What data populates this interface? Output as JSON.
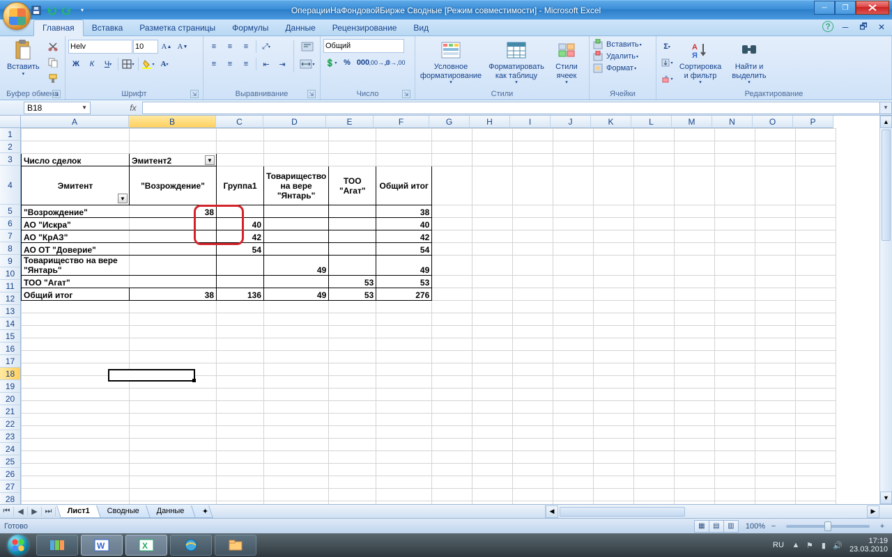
{
  "window": {
    "title": "ОперацииНаФондовойБирже  Сводные  [Режим совместимости] - Microsoft Excel"
  },
  "tabs": {
    "items": [
      "Главная",
      "Вставка",
      "Разметка страницы",
      "Формулы",
      "Данные",
      "Рецензирование",
      "Вид"
    ],
    "active_index": 0
  },
  "ribbon": {
    "clipboard": {
      "label": "Буфер обмена",
      "paste": "Вставить"
    },
    "font": {
      "label": "Шрифт",
      "family": "Helv",
      "size": "10"
    },
    "alignment": {
      "label": "Выравнивание"
    },
    "number": {
      "label": "Число",
      "format": "Общий"
    },
    "styles": {
      "label": "Стили",
      "conditional": "Условное форматирование",
      "as_table": "Форматировать как таблицу",
      "cell_styles": "Стили ячеек"
    },
    "cells": {
      "label": "Ячейки",
      "insert": "Вставить",
      "delete": "Удалить",
      "format": "Формат"
    },
    "editing": {
      "label": "Редактирование",
      "sort": "Сортировка и фильтр",
      "find": "Найти и выделить"
    }
  },
  "formula_bar": {
    "namebox": "B18",
    "fx_label": "fx",
    "formula": ""
  },
  "column_letters": [
    "A",
    "B",
    "C",
    "D",
    "E",
    "F",
    "G",
    "H",
    "I",
    "J",
    "K",
    "L",
    "M",
    "N",
    "O",
    "P"
  ],
  "row_numbers": [
    1,
    2,
    3,
    4,
    5,
    6,
    7,
    8,
    9,
    10,
    11,
    12,
    13,
    14,
    15,
    16,
    17,
    18,
    19,
    20,
    21,
    22,
    23,
    24,
    25,
    26,
    27,
    28
  ],
  "pivot": {
    "measure_label": "Число сделок",
    "col_field": "Эмитент2",
    "row_field": "Эмитент",
    "col_headers": [
      "\"Возрождение\"",
      "Группа1",
      "Товарищество на вере \"Янтарь\"",
      "ТОО \"Агат\"",
      "Общий итог"
    ],
    "rows": [
      {
        "label": "\"Возрождение\"",
        "values": [
          "38",
          "",
          "",
          "",
          "38"
        ]
      },
      {
        "label": "АО \"Искра\"",
        "values": [
          "",
          "40",
          "",
          "",
          "40"
        ]
      },
      {
        "label": "АО \"КрАЗ\"",
        "values": [
          "",
          "42",
          "",
          "",
          "42"
        ]
      },
      {
        "label": "АО ОТ \"Доверие\"",
        "values": [
          "",
          "54",
          "",
          "",
          "54"
        ]
      },
      {
        "label": "Товарищество на вере \"Янтарь\"",
        "values": [
          "",
          "",
          "49",
          "",
          "49"
        ]
      },
      {
        "label": "ТОО \"Агат\"",
        "values": [
          "",
          "",
          "",
          "53",
          "53"
        ]
      }
    ],
    "total_label": "Общий итог",
    "totals": [
      "38",
      "136",
      "49",
      "53",
      "276"
    ]
  },
  "sheets": {
    "items": [
      "Лист1",
      "Сводные",
      "Данные"
    ],
    "active_index": 0
  },
  "status": {
    "ready": "Готово",
    "zoom": "100%"
  },
  "taskbar": {
    "lang": "RU",
    "time": "17:19",
    "date": "23.03.2010"
  }
}
